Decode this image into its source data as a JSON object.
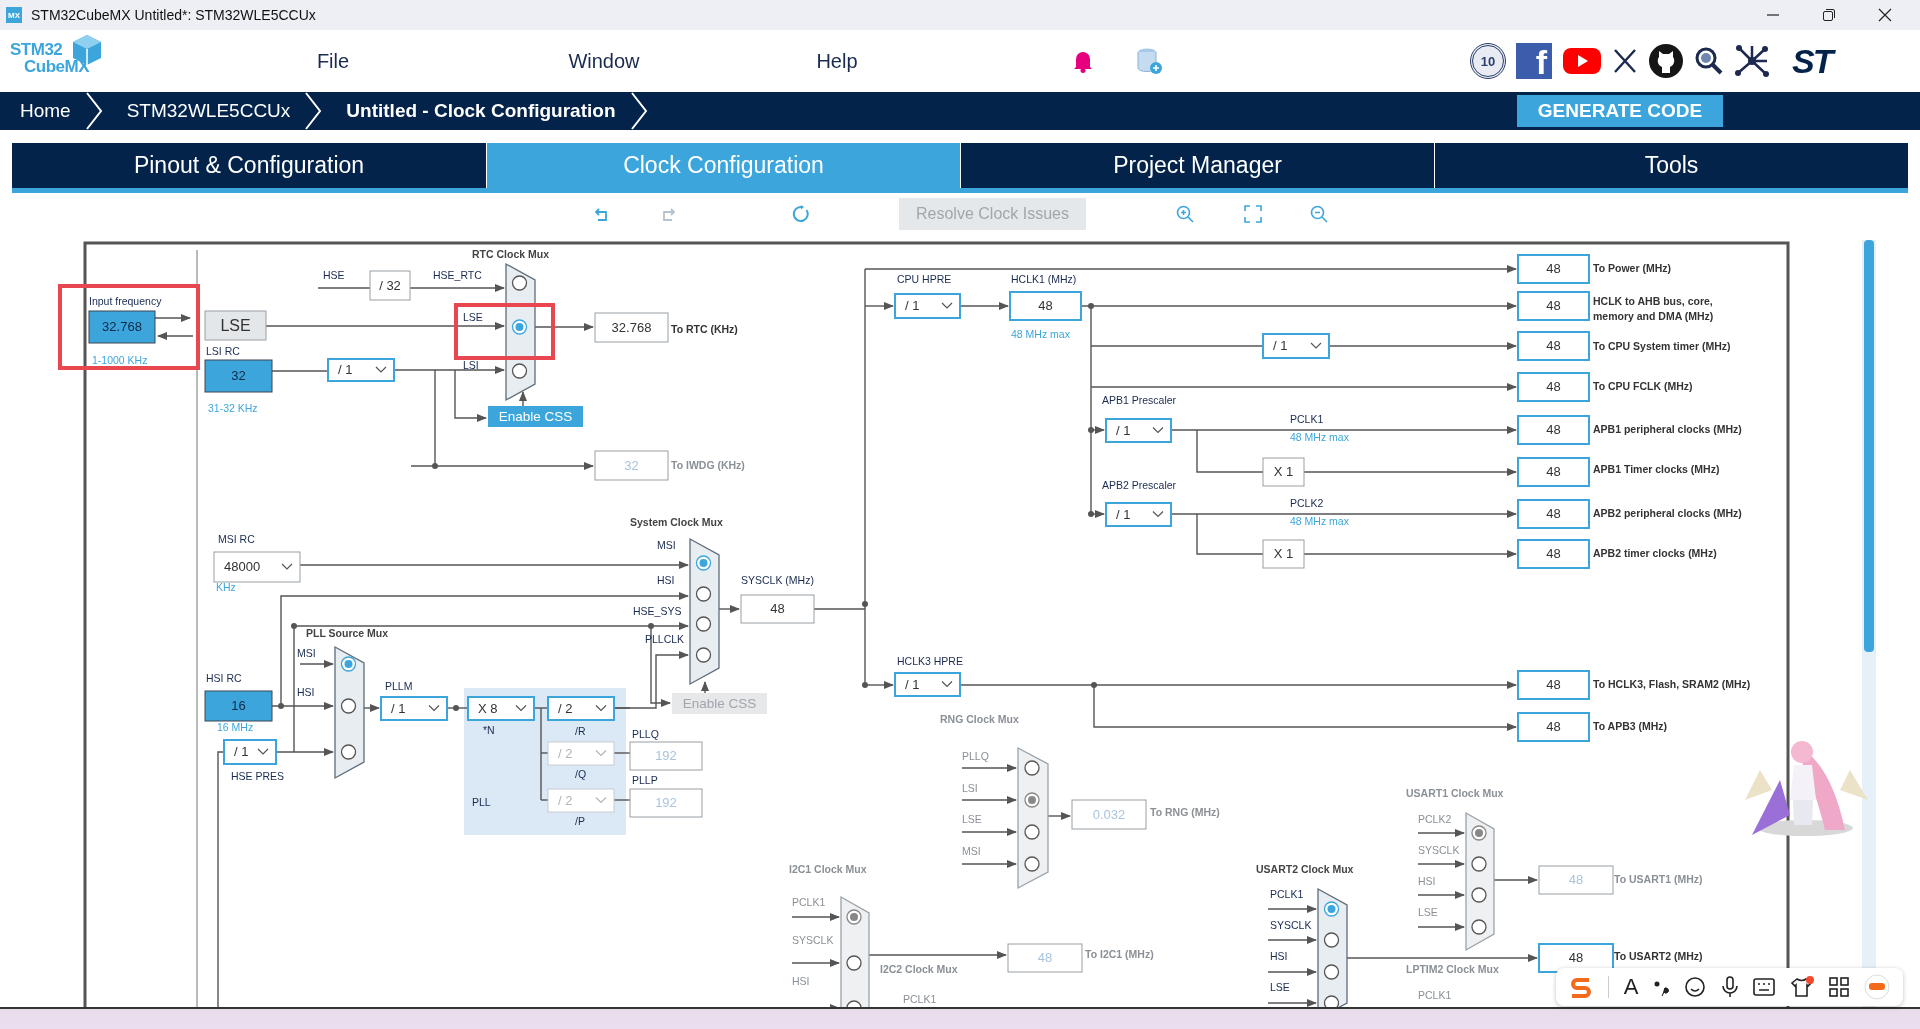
{
  "window": {
    "icon_text": "MX",
    "title": "STM32CubeMX Untitled*: STM32WLE5CCUx"
  },
  "header": {
    "logo": [
      "STM32",
      "CubeMX"
    ],
    "menu": [
      "File",
      "Window",
      "Help"
    ],
    "badge_text": "10",
    "facebook_glyph": "f",
    "brand_logo": "ST"
  },
  "breadcrumb": [
    {
      "label": "Home",
      "current": false
    },
    {
      "label": "STM32WLE5CCUx",
      "current": false
    },
    {
      "label": "Untitled - Clock Configuration",
      "current": true
    }
  ],
  "generate_button": "GENERATE CODE",
  "tabs": [
    {
      "label": "Pinout & Configuration",
      "selected": false
    },
    {
      "label": "Clock Configuration",
      "selected": true
    },
    {
      "label": "Project Manager",
      "selected": false
    },
    {
      "label": "Tools",
      "selected": false
    }
  ],
  "toolbar": {
    "resolve": {
      "label": "Resolve Clock Issues",
      "disabled": true
    }
  },
  "diagram": {
    "labels": [
      {
        "text": "Input frequency",
        "kind": "signal"
      },
      {
        "text": "1-1000 KHz",
        "kind": "note"
      },
      {
        "text": "LSI RC",
        "kind": "signal"
      },
      {
        "text": "31-32 KHz",
        "kind": "note"
      },
      {
        "text": "RTC Clock Mux",
        "kind": "title"
      },
      {
        "text": "HSE",
        "kind": "signal"
      },
      {
        "text": "HSE_RTC",
        "kind": "signal"
      },
      {
        "text": "LSE",
        "kind": "signal"
      },
      {
        "text": "LSI",
        "kind": "signal"
      },
      {
        "text": "To RTC (KHz)",
        "kind": "output"
      },
      {
        "text": "To IWDG (KHz)",
        "kind": "dim_output"
      },
      {
        "text": "MSI RC",
        "kind": "signal"
      },
      {
        "text": "KHz",
        "kind": "note"
      },
      {
        "text": "System Clock Mux",
        "kind": "title"
      },
      {
        "text": "MSI",
        "kind": "signal"
      },
      {
        "text": "HSI",
        "kind": "signal"
      },
      {
        "text": "HSE_SYS",
        "kind": "signal"
      },
      {
        "text": "PLLCLK",
        "kind": "signal"
      },
      {
        "text": "SYSCLK (MHz)",
        "kind": "signal"
      },
      {
        "text": "PLL Source Mux",
        "kind": "title"
      },
      {
        "text": "MSI",
        "kind": "signal"
      },
      {
        "text": "HSI",
        "kind": "signal"
      },
      {
        "text": "HSI RC",
        "kind": "signal"
      },
      {
        "text": "16 MHz",
        "kind": "note"
      },
      {
        "text": "HSE PRES",
        "kind": "signal"
      },
      {
        "text": "PLLM",
        "kind": "signal"
      },
      {
        "text": "*N",
        "kind": "signal"
      },
      {
        "text": "/R",
        "kind": "signal"
      },
      {
        "text": "/Q",
        "kind": "signal"
      },
      {
        "text": "/P",
        "kind": "signal"
      },
      {
        "text": "PLL",
        "kind": "signal"
      },
      {
        "text": "PLLQ",
        "kind": "signal"
      },
      {
        "text": "PLLP",
        "kind": "signal"
      },
      {
        "text": "CPU HPRE",
        "kind": "signal"
      },
      {
        "text": "HCLK1 (MHz)",
        "kind": "signal"
      },
      {
        "text": "48 MHz max",
        "kind": "note"
      },
      {
        "text": "APB1 Prescaler",
        "kind": "signal"
      },
      {
        "text": "PCLK1",
        "kind": "signal"
      },
      {
        "text": "48 MHz max",
        "kind": "note"
      },
      {
        "text": "APB2 Prescaler",
        "kind": "signal"
      },
      {
        "text": "PCLK2",
        "kind": "signal"
      },
      {
        "text": "48 MHz max",
        "kind": "note"
      },
      {
        "text": "HCLK3 HPRE",
        "kind": "signal"
      },
      {
        "text": "RNG Clock Mux",
        "kind": "dim_title"
      },
      {
        "text": "PLLQ",
        "kind": "dim_signal"
      },
      {
        "text": "LSI",
        "kind": "dim_signal"
      },
      {
        "text": "LSE",
        "kind": "dim_signal"
      },
      {
        "text": "MSI",
        "kind": "dim_signal"
      },
      {
        "text": "To RNG (MHz)",
        "kind": "dim_output"
      },
      {
        "text": "I2C1 Clock Mux",
        "kind": "dim_title"
      },
      {
        "text": "PCLK1",
        "kind": "dim_signal"
      },
      {
        "text": "SYSCLK",
        "kind": "dim_signal"
      },
      {
        "text": "HSI",
        "kind": "dim_signal"
      },
      {
        "text": "To I2C1 (MHz)",
        "kind": "dim_output"
      },
      {
        "text": "I2C2 Clock Mux",
        "kind": "dim_title"
      },
      {
        "text": "PCLK1",
        "kind": "dim_signal"
      },
      {
        "text": "To Power (MHz)",
        "kind": "output"
      },
      {
        "text": "HCLK to AHB bus, core,",
        "kind": "output"
      },
      {
        "text": "memory and DMA (MHz)",
        "kind": "output"
      },
      {
        "text": "To CPU System timer (MHz)",
        "kind": "output"
      },
      {
        "text": "To CPU FCLK (MHz)",
        "kind": "output"
      },
      {
        "text": "APB1 peripheral clocks (MHz)",
        "kind": "output"
      },
      {
        "text": "APB1 Timer clocks (MHz)",
        "kind": "output"
      },
      {
        "text": "APB2 peripheral clocks (MHz)",
        "kind": "output"
      },
      {
        "text": "APB2 timer clocks (MHz)",
        "kind": "output"
      },
      {
        "text": "To HCLK3, Flash, SRAM2 (MHz)",
        "kind": "output"
      },
      {
        "text": "To APB3 (MHz)",
        "kind": "output"
      },
      {
        "text": "USART1 Clock Mux",
        "kind": "dim_title"
      },
      {
        "text": "PCLK2",
        "kind": "dim_signal"
      },
      {
        "text": "SYSCLK",
        "kind": "dim_signal"
      },
      {
        "text": "HSI",
        "kind": "dim_signal"
      },
      {
        "text": "LSE",
        "kind": "dim_signal"
      },
      {
        "text": "To USART1 (MHz)",
        "kind": "dim_output"
      },
      {
        "text": "USART2 Clock Mux",
        "kind": "title"
      },
      {
        "text": "PCLK1",
        "kind": "signal"
      },
      {
        "text": "SYSCLK",
        "kind": "signal"
      },
      {
        "text": "HSI",
        "kind": "signal"
      },
      {
        "text": "LSE",
        "kind": "signal"
      },
      {
        "text": "To USART2 (MHz)",
        "kind": "output"
      },
      {
        "text": "LPTIM2 Clock Mux",
        "kind": "dim_title"
      },
      {
        "text": "PCLK1",
        "kind": "dim_signal"
      }
    ],
    "fields": [
      {
        "value": "32.768",
        "kind": "input"
      },
      {
        "value": "LSE",
        "kind": "source"
      },
      {
        "value": "32",
        "kind": "input"
      },
      {
        "value": "/ 32",
        "kind": "plain"
      },
      {
        "value": "32.768",
        "kind": "plain"
      },
      {
        "value": "32",
        "kind": "disabled"
      },
      {
        "value": "48",
        "kind": "plain"
      },
      {
        "value": "16",
        "kind": "input"
      },
      {
        "value": "192",
        "kind": "disabled"
      },
      {
        "value": "192",
        "kind": "disabled"
      },
      {
        "value": "48",
        "kind": "output"
      },
      {
        "value": "X 1",
        "kind": "plain"
      },
      {
        "value": "X 1",
        "kind": "plain"
      },
      {
        "value": "48",
        "kind": "output"
      },
      {
        "value": "48",
        "kind": "output"
      },
      {
        "value": "48",
        "kind": "output"
      },
      {
        "value": "48",
        "kind": "output"
      },
      {
        "value": "48",
        "kind": "output"
      },
      {
        "value": "48",
        "kind": "output"
      },
      {
        "value": "48",
        "kind": "output"
      },
      {
        "value": "48",
        "kind": "output"
      },
      {
        "value": "48",
        "kind": "output"
      },
      {
        "value": "48",
        "kind": "output"
      },
      {
        "value": "0.032",
        "kind": "disabled"
      },
      {
        "value": "48",
        "kind": "disabled"
      },
      {
        "value": "48",
        "kind": "disabled"
      },
      {
        "value": "48",
        "kind": "output"
      }
    ],
    "dropdowns": [
      {
        "value": "/ 1",
        "kind": "select",
        "disabled": false
      },
      {
        "value": "48000",
        "kind": "combo",
        "disabled": false
      },
      {
        "value": "/ 1",
        "kind": "select",
        "disabled": false
      },
      {
        "value": "/ 1",
        "kind": "select",
        "disabled": false
      },
      {
        "value": "X 8",
        "kind": "select",
        "disabled": false
      },
      {
        "value": "/ 2",
        "kind": "select",
        "disabled": false
      },
      {
        "value": "/ 2",
        "kind": "select",
        "disabled": true
      },
      {
        "value": "/ 2",
        "kind": "select",
        "disabled": true
      },
      {
        "value": "/ 1",
        "kind": "select",
        "disabled": false
      },
      {
        "value": "/ 1",
        "kind": "select",
        "disabled": false
      },
      {
        "value": "/ 1",
        "kind": "select",
        "disabled": false
      },
      {
        "value": "/ 1",
        "kind": "select",
        "disabled": false
      },
      {
        "value": "/ 1",
        "kind": "select",
        "disabled": false
      }
    ],
    "buttons": [
      {
        "label": "Enable CSS",
        "disabled": false
      },
      {
        "label": "Enable CSS",
        "disabled": true
      }
    ],
    "muxes": [
      {
        "active": true,
        "inputs": [
          {
            "selected": false
          },
          {
            "selected": true
          },
          {
            "selected": false
          }
        ]
      },
      {
        "active": true,
        "inputs": [
          {
            "selected": true
          },
          {
            "selected": false
          },
          {
            "selected": false
          }
        ]
      },
      {
        "active": true,
        "inputs": [
          {
            "selected": true
          },
          {
            "selected": false
          },
          {
            "selected": false
          },
          {
            "selected": false
          }
        ]
      },
      {
        "active": false,
        "inputs": [
          {
            "selected": false
          },
          {
            "selected": true
          },
          {
            "selected": false
          },
          {
            "selected": false
          }
        ]
      },
      {
        "active": false,
        "inputs": [
          {
            "selected": true
          },
          {
            "selected": false
          },
          {
            "selected": false
          }
        ]
      },
      {
        "active": false,
        "inputs": [
          {
            "selected": true
          },
          {
            "selected": false
          },
          {
            "selected": false
          },
          {
            "selected": false
          }
        ]
      },
      {
        "active": true,
        "inputs": [
          {
            "selected": true
          },
          {
            "selected": false
          },
          {
            "selected": false
          },
          {
            "selected": false
          }
        ]
      }
    ]
  },
  "ime_toolbar": {
    "letter": "A"
  }
}
